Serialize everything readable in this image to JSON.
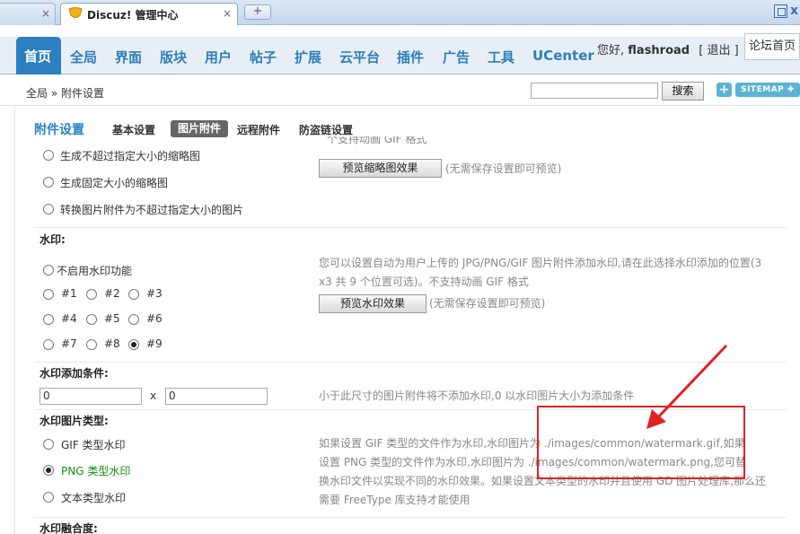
{
  "browser": {
    "inactive_tab_close": "×",
    "active_tab_title": "Discuz! 管理中心",
    "active_tab_close": "×",
    "new_tab": "+",
    "window_close": "x"
  },
  "header": {
    "nav": [
      {
        "label": "首页",
        "active": true
      },
      {
        "label": "全局"
      },
      {
        "label": "界面"
      },
      {
        "label": "版块"
      },
      {
        "label": "用户"
      },
      {
        "label": "帖子"
      },
      {
        "label": "扩展"
      },
      {
        "label": "云平台"
      },
      {
        "label": "插件"
      },
      {
        "label": "广告"
      },
      {
        "label": "工具"
      },
      {
        "label": "UCenter"
      }
    ],
    "greeting_prefix": "您好,",
    "username": "flashroad",
    "logout": "[ 退出 ]",
    "bbs_home": "论坛首页"
  },
  "breadcrumb": {
    "text": "全局 » 附件设置",
    "search_value": "",
    "search_button": "搜索",
    "plus": "+",
    "sitemap": "SITEMAP ✚"
  },
  "subnav": {
    "title": "附件设置",
    "tabs": [
      "基本设置",
      "图片附件",
      "远程附件",
      "防盗链设置"
    ],
    "active_index": 1
  },
  "thumbnail": {
    "options": [
      "生成不超过指定大小的缩略图",
      "生成固定大小的缩略图",
      "转换图片附件为不超过指定大小的图片"
    ],
    "truncated_hint": "个支持动画 GIF 格式",
    "preview_button": "预览缩略图效果",
    "preview_hint": "(无需保存设置即可预览)"
  },
  "watermark": {
    "heading": "水印:",
    "disable_label": "不启用水印功能",
    "positions": [
      "#1",
      "#2",
      "#3",
      "#4",
      "#5",
      "#6",
      "#7",
      "#8",
      "#9"
    ],
    "selected_position": "#9",
    "hint_line1": "您可以设置自动为用户上传的 JPG/PNG/GIF 图片附件添加水印,请在此选择水印添加的位置(3",
    "hint_line2": "x3 共 9 个位置可选)。不支持动画 GIF 格式",
    "preview_button": "预览水印效果",
    "preview_hint": "(无需保存设置即可预览)"
  },
  "condition": {
    "heading": "水印添加条件:",
    "width": "0",
    "x": "x",
    "height": "0",
    "hint": "小于此尺寸的图片附件将不添加水印,0 以水印图片大小为添加条件"
  },
  "image_type": {
    "heading": "水印图片类型:",
    "options": [
      "GIF 类型水印",
      "PNG 类型水印",
      "文本类型水印"
    ],
    "selected_index": 1,
    "hint_line1": "如果设置 GIF 类型的文件作为水印,水印图片为 ./images/common/watermark.gif,如果",
    "hint_line2": "设置 PNG 类型的文件作为水印,水印图片为 ./images/common/watermark.png,您可替",
    "hint_line3": "换水印文件以实现不同的水印效果。如果设置文本类型的水印并且使用 GD 图片处理库,那么还",
    "hint_line4": "需要 FreeType 库支持才能使用"
  },
  "blend": {
    "heading": "水印融合度:"
  },
  "colors": {
    "nav_blue": "#2d7fba",
    "active_tab_bg": "#2e7fc2",
    "annotation_red": "#e02222",
    "selected_green": "#1a8a1a"
  }
}
